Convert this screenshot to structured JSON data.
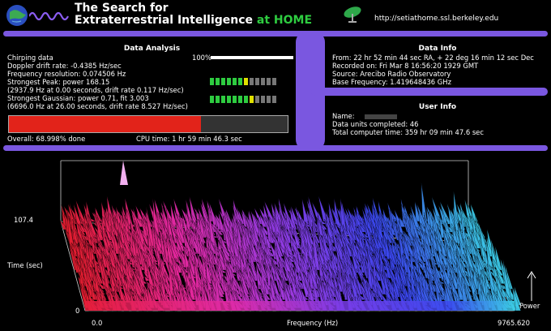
{
  "header": {
    "title_line1": "The Search for",
    "title_line2": "Extraterrestrial Intelligence",
    "title_suffix": "at HOME",
    "url": "http://setiathome.ssl.berkeley.edu"
  },
  "data_analysis": {
    "title": "Data Analysis",
    "lines": [
      "Chirping data",
      "Doppler drift rate: -0.4385 Hz/sec",
      "Frequency resolution: 0.074506 Hz",
      "Strongest Peak: power 168.15",
      "(2937.9 Hz at  0.00 seconds, drift rate 0.117 Hz/sec)",
      "Strongest Gaussian: power  0.71, fit 3.003",
      "(6696.0 Hz at 26.00 seconds, drift rate 8.527 Hz/sec)"
    ],
    "meter_label": "100%",
    "progress_fraction": 0.69,
    "overall": "Overall: 68.998% done",
    "cpu_time": "CPU time: 1 hr 59 min 46.3 sec"
  },
  "data_info": {
    "title": "Data Info",
    "lines": [
      "From: 22 hr 52 min 44 sec RA, + 22 deg 16 min 12 sec Dec",
      "Recorded on: Fri Mar  8 16:56:20 1929 GMT",
      "Source: Arecibo Radio Observatory",
      "Base Frequency: 1.419648436 GHz"
    ]
  },
  "user_info": {
    "title": "User Info",
    "name_label": "Name:",
    "lines": [
      "Data units completed: 46",
      "Total computer time: 359 hr 09 min 47.6 sec"
    ]
  },
  "plot": {
    "y_top": "107.4",
    "y_bottom": "0",
    "y_label": "Time (sec)",
    "x_left": "0.0",
    "x_right": "9765.620",
    "x_label": "Frequency (Hz)",
    "z_label": "Power"
  },
  "colors": {
    "accent": "#7a57e0",
    "home_green": "#2ecc40",
    "progress_red": "#e2231a"
  }
}
